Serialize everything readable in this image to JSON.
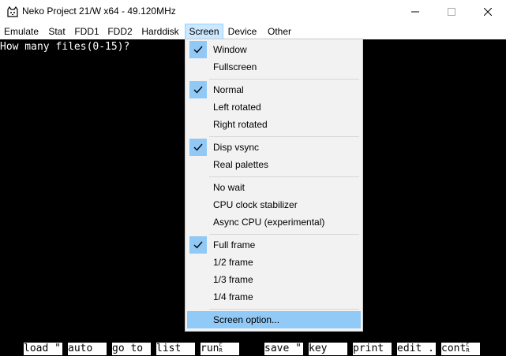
{
  "window": {
    "title": "Neko Project 21/W x64 - 49.120MHz",
    "icon": "cat-icon"
  },
  "menubar": [
    "Emulate",
    "Stat",
    "FDD1",
    "FDD2",
    "Harddisk",
    "Screen",
    "Device",
    "Other"
  ],
  "active_menu": "Screen",
  "screen_menu": {
    "items": {
      "window": {
        "label": "Window",
        "checked": true
      },
      "fullscreen": {
        "label": "Fullscreen",
        "checked": false
      },
      "normal": {
        "label": "Normal",
        "checked": true
      },
      "left_rotated": {
        "label": "Left rotated",
        "checked": false
      },
      "right_rotated": {
        "label": "Right rotated",
        "checked": false
      },
      "disp_vsync": {
        "label": "Disp vsync",
        "checked": true
      },
      "real_palettes": {
        "label": "Real palettes",
        "checked": false
      },
      "no_wait": {
        "label": "No wait",
        "checked": false
      },
      "cpu_clock_stabilizer": {
        "label": "CPU clock stabilizer",
        "checked": false
      },
      "async_cpu": {
        "label": "Async CPU (experimental)",
        "checked": false
      },
      "full_frame": {
        "label": "Full frame",
        "checked": true
      },
      "half_frame": {
        "label": "1/2 frame",
        "checked": false
      },
      "third_frame": {
        "label": "1/3 frame",
        "checked": false
      },
      "quarter_frame": {
        "label": "1/4 frame",
        "checked": false
      },
      "screen_option": {
        "label": "Screen option...",
        "checked": false,
        "highlighted": true
      }
    }
  },
  "screen": {
    "prompt": "How many files(0-15)?",
    "function_keys": [
      "load \"",
      "auto",
      "go to",
      "list",
      "run",
      "save \"",
      "key",
      "print",
      "edit .",
      "cont"
    ],
    "run_sup": "C",
    "run_sub": "R",
    "cont_sup": "C",
    "cont_sub": "R"
  },
  "colors": {
    "menu_bg": "#f2f2f2",
    "highlight": "#91c9f7",
    "check_bg": "#90c8f6",
    "active_menu_bg": "#cce8ff",
    "screen_bg": "#000000",
    "text": "#ffffff"
  }
}
